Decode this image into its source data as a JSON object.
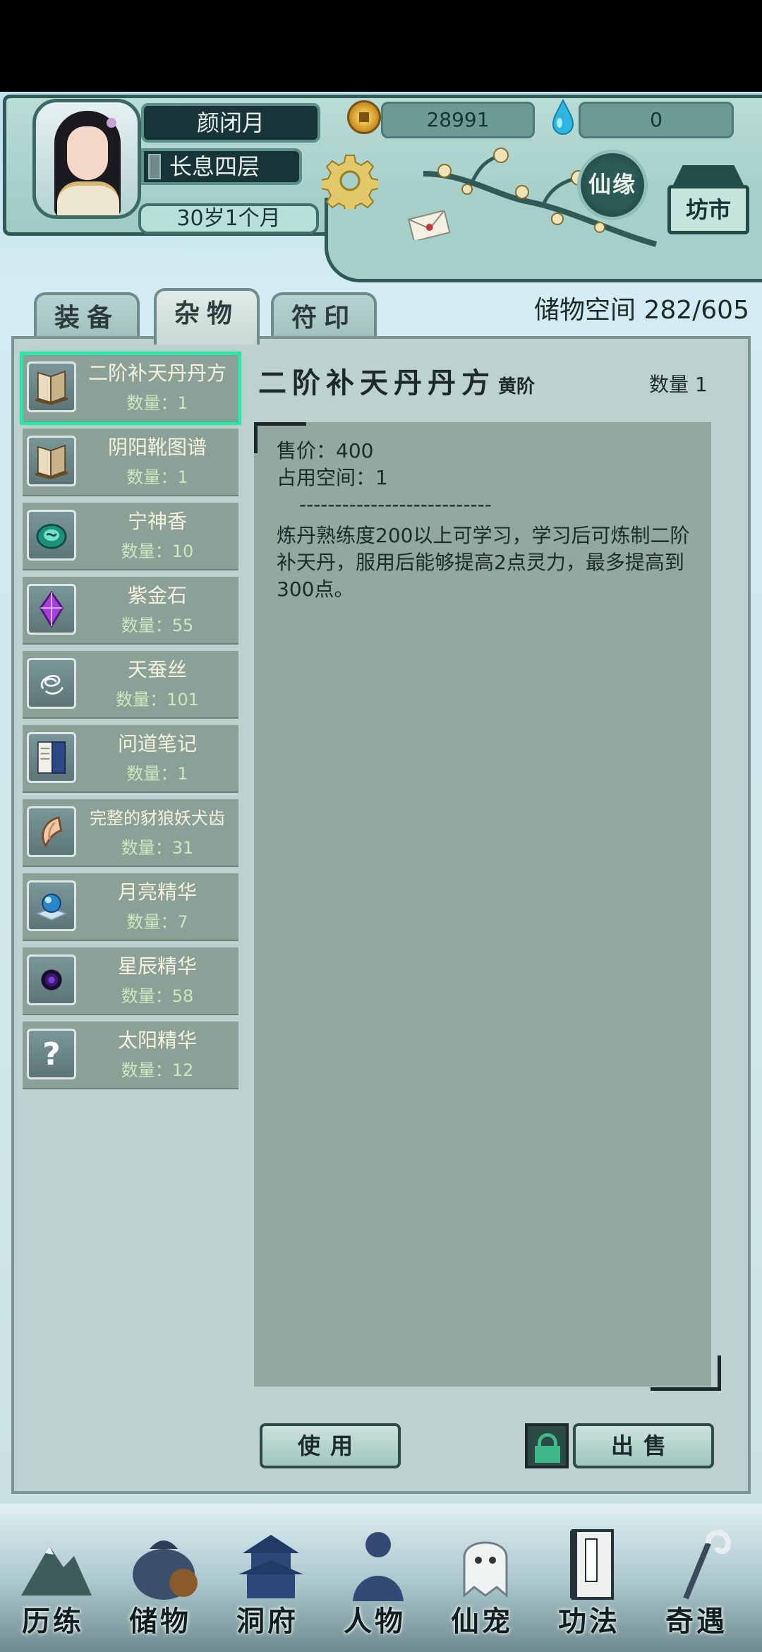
{
  "player": {
    "name": "颜闭月",
    "realm": "长息四层",
    "age": "30岁1个月"
  },
  "currency": {
    "coins": "28991",
    "spirit_stones": "0"
  },
  "header_buttons": {
    "xianyuan": "仙缘",
    "fangshi": "坊市"
  },
  "tabs": [
    {
      "label": "装备"
    },
    {
      "label": "杂物"
    },
    {
      "label": "符印"
    }
  ],
  "storage": {
    "label": "储物空间",
    "value": "282/605"
  },
  "items": [
    {
      "name": "二阶补天丹丹方",
      "count": "数量：1",
      "icon": "book-icon"
    },
    {
      "name": "阴阳靴图谱",
      "count": "数量：1",
      "icon": "book-icon"
    },
    {
      "name": "宁神香",
      "count": "数量：10",
      "icon": "incense-icon"
    },
    {
      "name": "紫金石",
      "count": "数量：55",
      "icon": "purple-gem-icon"
    },
    {
      "name": "天蚕丝",
      "count": "数量：101",
      "icon": "silk-icon"
    },
    {
      "name": "问道笔记",
      "count": "数量：1",
      "icon": "notebook-icon"
    },
    {
      "name": "完整的豺狼妖犬齿",
      "count": "数量：31",
      "icon": "fang-icon"
    },
    {
      "name": "月亮精华",
      "count": "数量：7",
      "icon": "moon-orb-icon"
    },
    {
      "name": "星辰精华",
      "count": "数量：58",
      "icon": "star-orb-icon"
    },
    {
      "name": "太阳精华",
      "count": "数量：12",
      "icon": "unknown-icon"
    }
  ],
  "detail": {
    "title": "二阶补天丹丹方",
    "grade": "黄阶",
    "quantity": "数量 1",
    "price": "售价：400",
    "space": "占用空间：1",
    "separator": "---------------------------",
    "description": "炼丹熟练度200以上可学习，学习后可炼制二阶补天丹，服用后能够提高2点灵力，最多提高到300点。"
  },
  "actions": {
    "use": "使用",
    "sell": "出售"
  },
  "nav": [
    {
      "label": "历练"
    },
    {
      "label": "储物"
    },
    {
      "label": "洞府"
    },
    {
      "label": "人物"
    },
    {
      "label": "仙宠"
    },
    {
      "label": "功法"
    },
    {
      "label": "奇遇"
    }
  ],
  "colors": {
    "selected_outline": "#2de3a6",
    "panel_bg": "#bfd1cf",
    "item_bg": "#8ba198",
    "dark_plate": "#173538"
  }
}
